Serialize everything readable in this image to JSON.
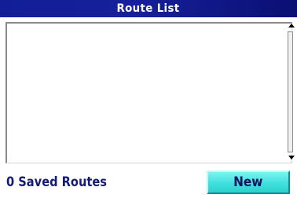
{
  "window": {
    "title": "Route List"
  },
  "route_list": {
    "items": []
  },
  "status": {
    "saved_routes": "0 Saved Routes"
  },
  "actions": {
    "new_label": "New"
  },
  "colors": {
    "title_bar": "#16209a",
    "status_text": "#141b74",
    "new_button": "#3fe0dd"
  }
}
